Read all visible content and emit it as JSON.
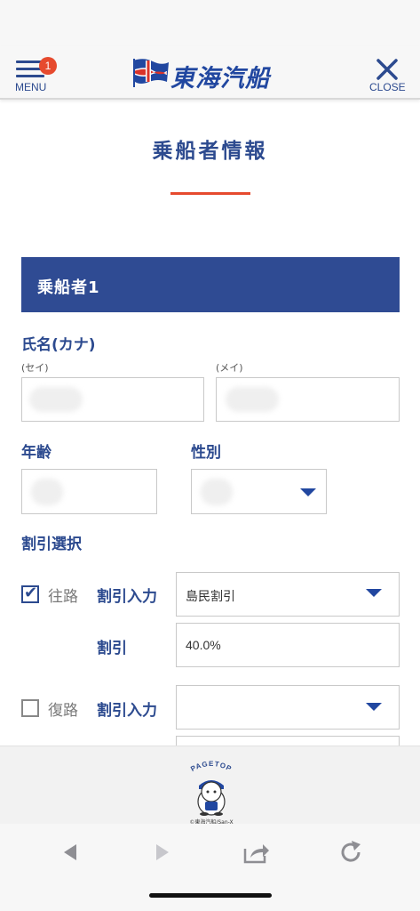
{
  "header": {
    "menu_label": "MENU",
    "menu_badge": "1",
    "brand": "東海汽船",
    "close_label": "CLOSE"
  },
  "page": {
    "title": "乗船者情報"
  },
  "passenger": {
    "section_title": "乗船者1",
    "name_label": "氏名(カナ)",
    "sei_label": "(セイ)",
    "mei_label": "(メイ)",
    "age_label": "年齢",
    "gender_label": "性別",
    "discount_select_label": "割引選択",
    "outbound": {
      "checked": true,
      "label": "往路",
      "discount_input_label": "割引入力",
      "discount_input_value": "島民割引",
      "discount_label": "割引",
      "discount_value": "40.0%"
    },
    "return": {
      "checked": false,
      "label": "復路",
      "discount_input_label": "割引入力",
      "discount_input_value": ""
    }
  },
  "footer": {
    "pagetop_label": "PAGETOP",
    "copyright": "©東海汽船/San-X"
  },
  "toolbar": {
    "back_icon": "back-arrow-icon",
    "forward_icon": "forward-arrow-icon",
    "share_icon": "share-icon",
    "reload_icon": "reload-icon"
  },
  "colors": {
    "brand_blue": "#2c4a8f",
    "section_bar": "#2f4b93",
    "accent_red": "#e64a2e"
  }
}
